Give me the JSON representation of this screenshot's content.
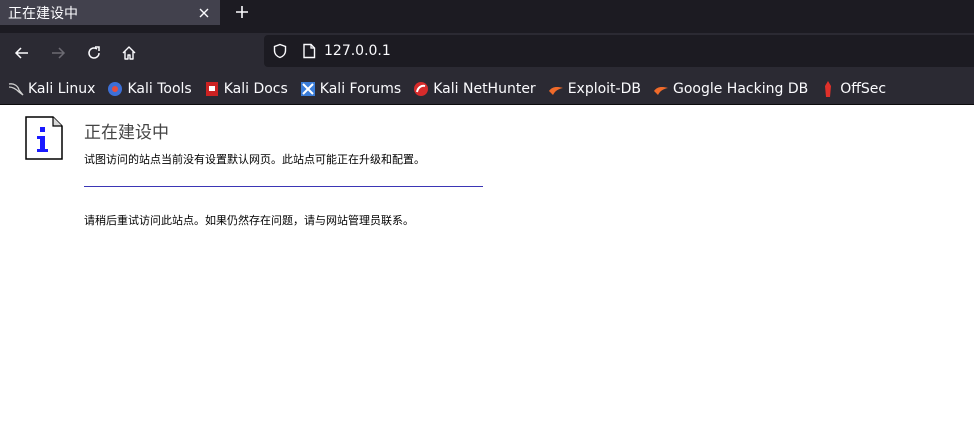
{
  "tab": {
    "title": "正在建设中",
    "close_icon": "close-icon",
    "new_tab_icon": "plus-icon"
  },
  "nav": {
    "back_icon": "back-arrow-icon",
    "forward_icon": "forward-arrow-icon",
    "reload_icon": "reload-icon",
    "home_icon": "home-icon",
    "url": "127.0.0.1"
  },
  "bookmarks": [
    {
      "label": "Kali Linux",
      "icon": "kali-dragon-icon"
    },
    {
      "label": "Kali Tools",
      "icon": "kali-tools-icon"
    },
    {
      "label": "Kali Docs",
      "icon": "kali-docs-icon"
    },
    {
      "label": "Kali Forums",
      "icon": "kali-forums-icon"
    },
    {
      "label": "Kali NetHunter",
      "icon": "nethunter-icon"
    },
    {
      "label": "Exploit-DB",
      "icon": "exploit-db-icon"
    },
    {
      "label": "Google Hacking DB",
      "icon": "ghdb-icon"
    },
    {
      "label": "OffSec",
      "icon": "offsec-icon"
    }
  ],
  "page": {
    "heading": "正在建设中",
    "message1": "试图访问的站点当前没有设置默认网页。此站点可能正在升级和配置。",
    "message2": "请稍后重试访问此站点。如果仍然存在问题，请与网站管理员联系。"
  },
  "colors": {
    "chrome_dark": "#1c1b22",
    "toolbar": "#2b2a33",
    "tab_active": "#42414d",
    "divider_line": "#3b36b5"
  }
}
